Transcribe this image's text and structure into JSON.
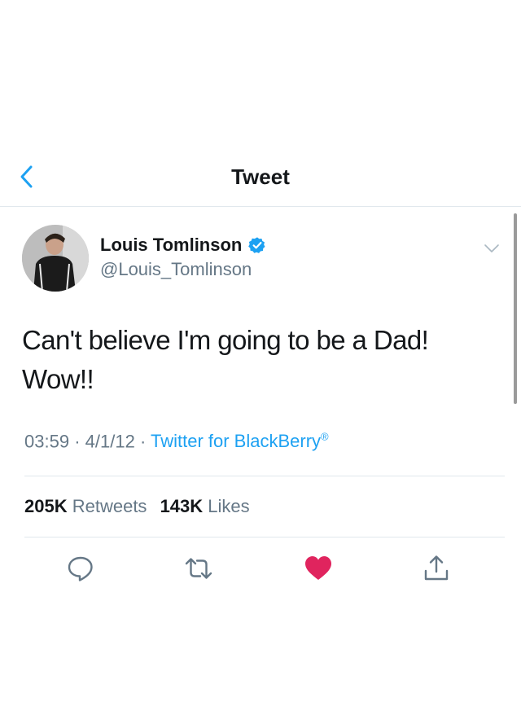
{
  "header": {
    "title": "Tweet",
    "back_icon": "chevron-left-icon"
  },
  "tweet": {
    "author_name": "Louis Tomlinson",
    "handle": "@Louis_Tomlinson",
    "verified": true,
    "text_line1": "Can't believe I'm going to be a Dad!",
    "text_line2": "Wow!!",
    "time": "03:59",
    "date": "4/1/12",
    "source": "Twitter for BlackBerry",
    "source_mark": "®",
    "retweets_count": "205K",
    "retweets_label": "Retweets",
    "likes_count": "143K",
    "likes_label": "Likes",
    "liked": true
  },
  "actions": [
    "reply-icon",
    "retweet-icon",
    "like-icon",
    "share-icon"
  ],
  "colors": {
    "accent": "#1da1f2",
    "like": "#e0245e",
    "secondary_text": "#657786"
  }
}
